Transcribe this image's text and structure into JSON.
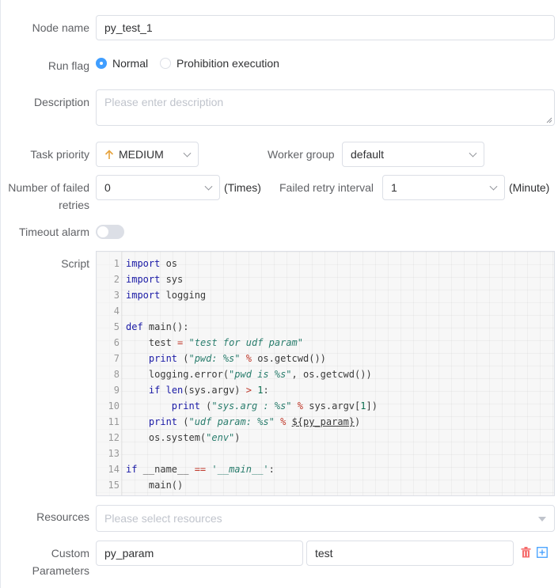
{
  "form": {
    "node_name": {
      "label": "Node name",
      "value": "py_test_1"
    },
    "run_flag": {
      "label": "Run flag",
      "options": [
        "Normal",
        "Prohibition execution"
      ],
      "selected": "Normal"
    },
    "description": {
      "label": "Description",
      "placeholder": "Please enter description"
    },
    "task_priority": {
      "label": "Task priority",
      "value": "MEDIUM"
    },
    "worker_group": {
      "label": "Worker group",
      "value": "default"
    },
    "failed_retries": {
      "label_line1": "Number of failed",
      "label_line2": "retries",
      "value": "0",
      "suffix": "(Times)"
    },
    "retry_interval": {
      "label": "Failed retry interval",
      "value": "1",
      "suffix": "(Minute)"
    },
    "timeout_alarm": {
      "label": "Timeout alarm",
      "enabled": false
    },
    "script": {
      "label": "Script"
    },
    "resources": {
      "label": "Resources",
      "placeholder": "Please select resources"
    },
    "custom_params": {
      "label_line1": "Custom",
      "label_line2": "Parameters",
      "prop": "py_param",
      "value": "test"
    }
  },
  "script_lines": [
    "import os",
    "import sys",
    "import logging",
    "",
    "def main():",
    "    test = \"test for udf param\"",
    "    print (\"pwd: %s\" % os.getcwd())",
    "    logging.error(\"pwd is %s\", os.getcwd())",
    "    if len(sys.argv) > 1:",
    "        print (\"sys.arg : %s\" % sys.argv[1])",
    "    print (\"udf param: %s\" % ${py_param})",
    "    os.system(\"env\")",
    "",
    "if __name__ == '__main__':",
    "    main()"
  ],
  "colors": {
    "accent": "#409eff",
    "priority_arrow": "#e6a23c",
    "delete_icon": "#f56c6c"
  },
  "icons": [
    "chevron-down-icon",
    "arrow-up-icon",
    "trash-icon",
    "add-square-icon"
  ]
}
